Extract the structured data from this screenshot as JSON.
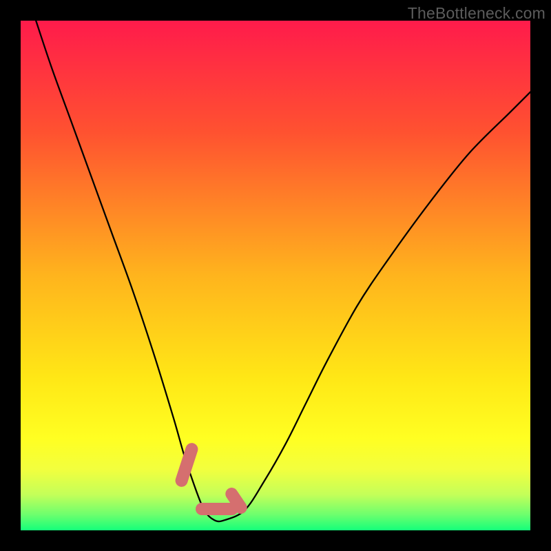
{
  "watermark": "TheBottleneck.com",
  "colors": {
    "background": "#000000",
    "gradient_top": "#ff1b4b",
    "gradient_mid1": "#ff6a2c",
    "gradient_mid2": "#ffd416",
    "gradient_mid3": "#ffff24",
    "gradient_mid4": "#e6ff52",
    "gradient_bottom": "#14ff7a",
    "curve": "#000000",
    "marker": "#d56f6f",
    "watermark": "#5c5c5c"
  },
  "chart_data": {
    "type": "line",
    "title": "",
    "xlabel": "",
    "ylabel": "",
    "xlim": [
      0,
      100
    ],
    "ylim": [
      0,
      100
    ],
    "series": [
      {
        "name": "bottleneck-curve",
        "x": [
          3,
          6,
          10,
          14,
          18,
          22,
          26,
          30,
          32,
          34,
          36,
          38,
          40,
          44,
          48,
          52,
          56,
          60,
          66,
          72,
          80,
          88,
          96,
          100
        ],
        "y": [
          100,
          91,
          80,
          69,
          58,
          47,
          35,
          22,
          15,
          9,
          4,
          2,
          2,
          4,
          10,
          17,
          25,
          33,
          44,
          53,
          64,
          74,
          82,
          86
        ]
      }
    ],
    "annotations": [
      {
        "name": "highlight-left-descend",
        "x": 33,
        "y": 13
      },
      {
        "name": "highlight-valley-floor",
        "x": 38,
        "y": 2
      },
      {
        "name": "highlight-right-ascend",
        "x": 42,
        "y": 3
      }
    ],
    "gradient_stops_pct": [
      0,
      22,
      50,
      70,
      82,
      88,
      93,
      97,
      100
    ],
    "gradient_colors": [
      "#ff1b4b",
      "#ff5230",
      "#ffb41d",
      "#ffe716",
      "#ffff22",
      "#f2ff3e",
      "#c4ff59",
      "#6bff6e",
      "#14ff7a"
    ]
  }
}
